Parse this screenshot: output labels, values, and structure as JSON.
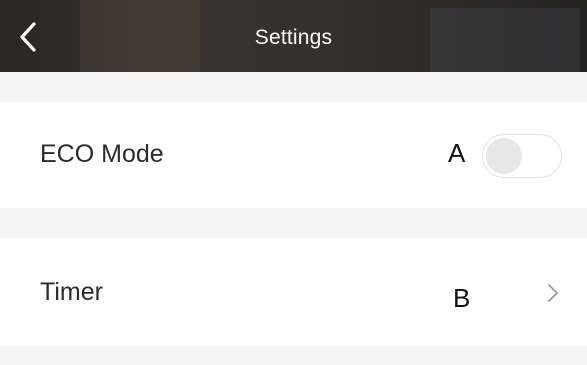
{
  "header": {
    "title": "Settings",
    "back_icon": "chevron-left-icon"
  },
  "settings": {
    "eco_mode": {
      "label": "ECO Mode",
      "marker": "A",
      "toggle_on": false
    },
    "timer": {
      "label": "Timer",
      "marker": "B",
      "chevron_icon": "chevron-right-icon"
    }
  },
  "colors": {
    "header_bg": "#2f2b29",
    "header_text": "#ffffff",
    "section_gap": "#f4f4f4",
    "row_bg": "#ffffff",
    "label_text": "#2b2b2b",
    "toggle_knob": "#e8e8e8",
    "chevron": "#9a9a9a"
  }
}
